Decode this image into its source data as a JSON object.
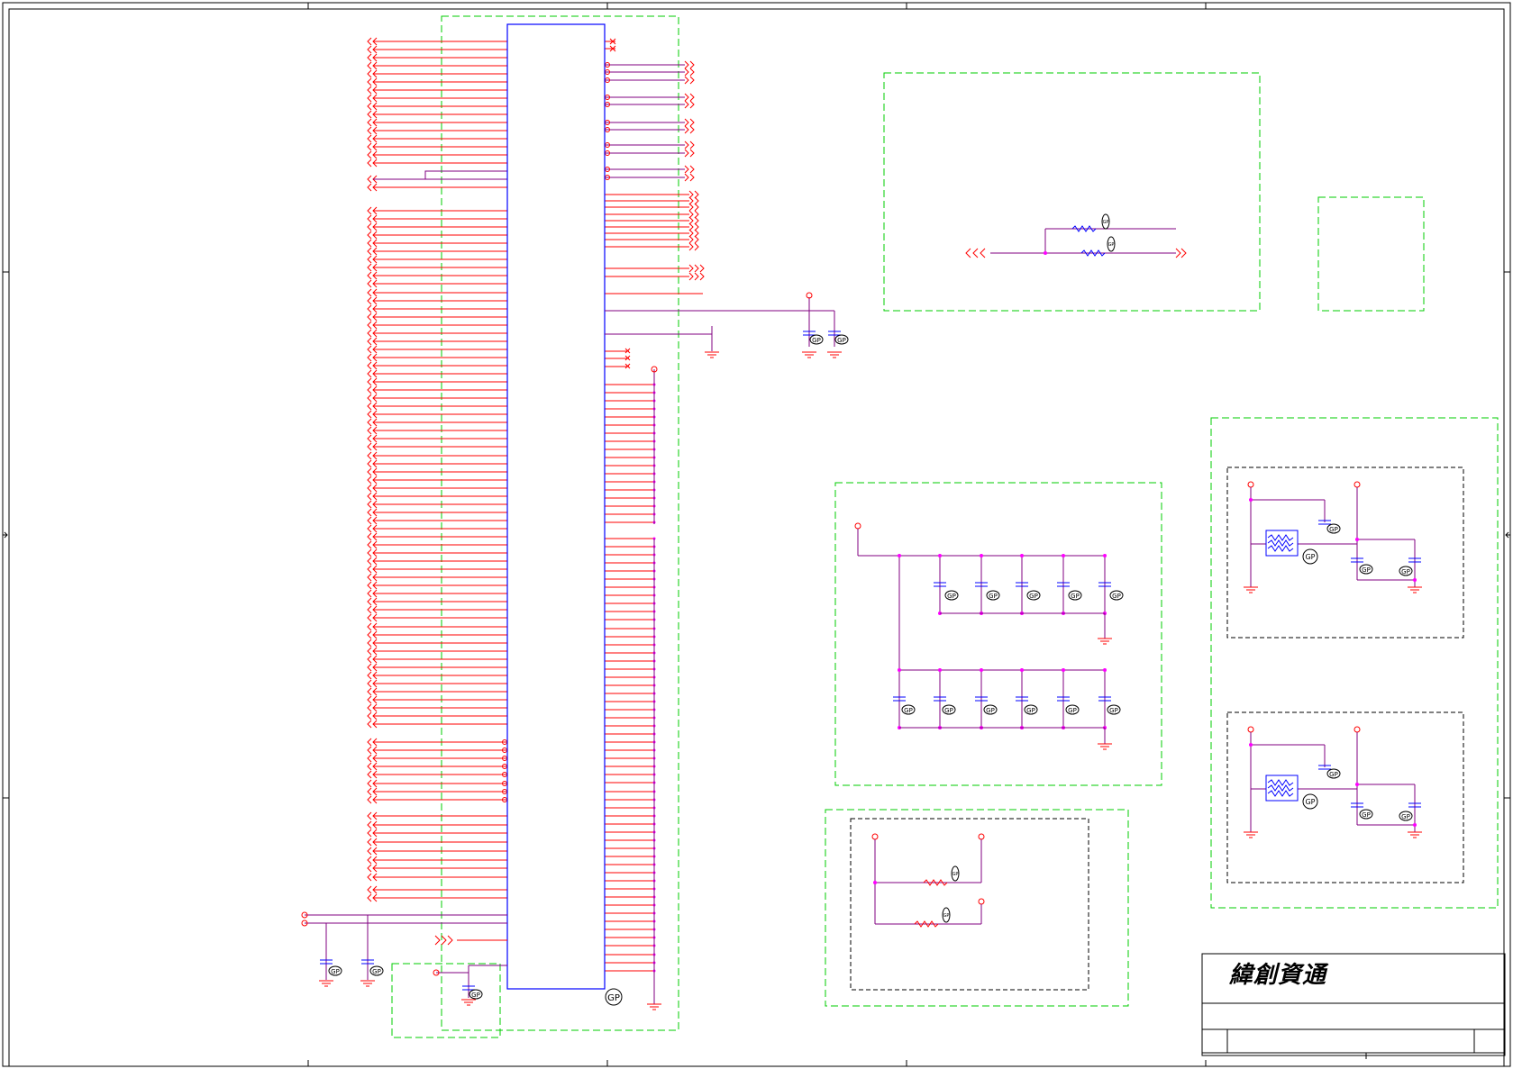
{
  "sheet": {
    "title_block": {
      "company": "緯創資通"
    }
  },
  "part_label": "GP",
  "colors": {
    "wire": "#ff0000",
    "net": "#800080",
    "component": "#0000ff",
    "block_border": "#00cc00",
    "sub_block_border": "#000000",
    "junction": "#ff00ff",
    "frame": "#000000"
  },
  "blocks": [
    {
      "id": "connector-block",
      "border": "green-dashed"
    },
    {
      "id": "pull-resistor-block",
      "border": "green-dashed"
    },
    {
      "id": "small-empty-block",
      "border": "green-dashed"
    },
    {
      "id": "decoupling-cap-block",
      "border": "green-dashed"
    },
    {
      "id": "filter-block",
      "border": "green-dashed"
    },
    {
      "id": "resistor-option-block",
      "border": "green-dashed"
    }
  ],
  "icons": [
    "ground-icon",
    "capacitor-icon",
    "resistor-icon",
    "net-arrow-icon",
    "inductor-bead-icon"
  ]
}
